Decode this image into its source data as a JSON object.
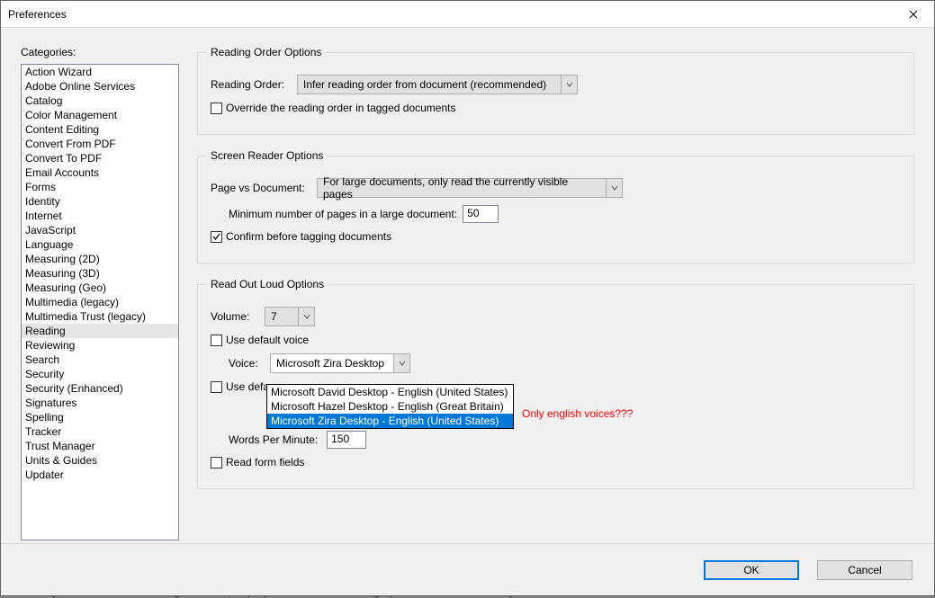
{
  "window": {
    "title": "Preferences"
  },
  "categories": {
    "label": "Categories:",
    "items": [
      "Action Wizard",
      "Adobe Online Services",
      "Catalog",
      "Color Management",
      "Content Editing",
      "Convert From PDF",
      "Convert To PDF",
      "Email Accounts",
      "Forms",
      "Identity",
      "Internet",
      "JavaScript",
      "Language",
      "Measuring (2D)",
      "Measuring (3D)",
      "Measuring (Geo)",
      "Multimedia (legacy)",
      "Multimedia Trust (legacy)",
      "Reading",
      "Reviewing",
      "Search",
      "Security",
      "Security (Enhanced)",
      "Signatures",
      "Spelling",
      "Tracker",
      "Trust Manager",
      "Units & Guides",
      "Updater"
    ],
    "selected": "Reading"
  },
  "reading_order": {
    "legend": "Reading Order Options",
    "order_label": "Reading Order:",
    "order_value": "Infer reading order from document (recommended)",
    "override_label": "Override the reading order in tagged documents",
    "override_checked": false
  },
  "screen_reader": {
    "legend": "Screen Reader Options",
    "pvd_label": "Page vs Document:",
    "pvd_value": "For large documents, only read the currently visible pages",
    "min_pages_label": "Minimum number of pages in a large document:",
    "min_pages_value": "50",
    "confirm_label": "Confirm before tagging documents",
    "confirm_checked": true
  },
  "read_loud": {
    "legend": "Read Out Loud Options",
    "volume_label": "Volume:",
    "volume_value": "7",
    "use_default_voice_label": "Use default voice",
    "use_default_voice_checked": false,
    "voice_label": "Voice:",
    "voice_value": "Microsoft Zira Desktop -",
    "voice_options": [
      "Microsoft David Desktop - English (United States)",
      "Microsoft Hazel Desktop - English (Great Britain)",
      "Microsoft Zira Desktop - English (United States)"
    ],
    "voice_highlight_index": 2,
    "use_default_speech_label": "Use defa",
    "wpm_label": "Words Per Minute:",
    "wpm_value": "150",
    "read_form_label": "Read form fields",
    "read_form_checked": false
  },
  "annotation": "Only english voices???",
  "buttons": {
    "ok": "OK",
    "cancel": "Cancel"
  },
  "background_text": "brojektforståelse med antagelsen om, at projekter i et stort omfang opererer i løst koblede systemer."
}
